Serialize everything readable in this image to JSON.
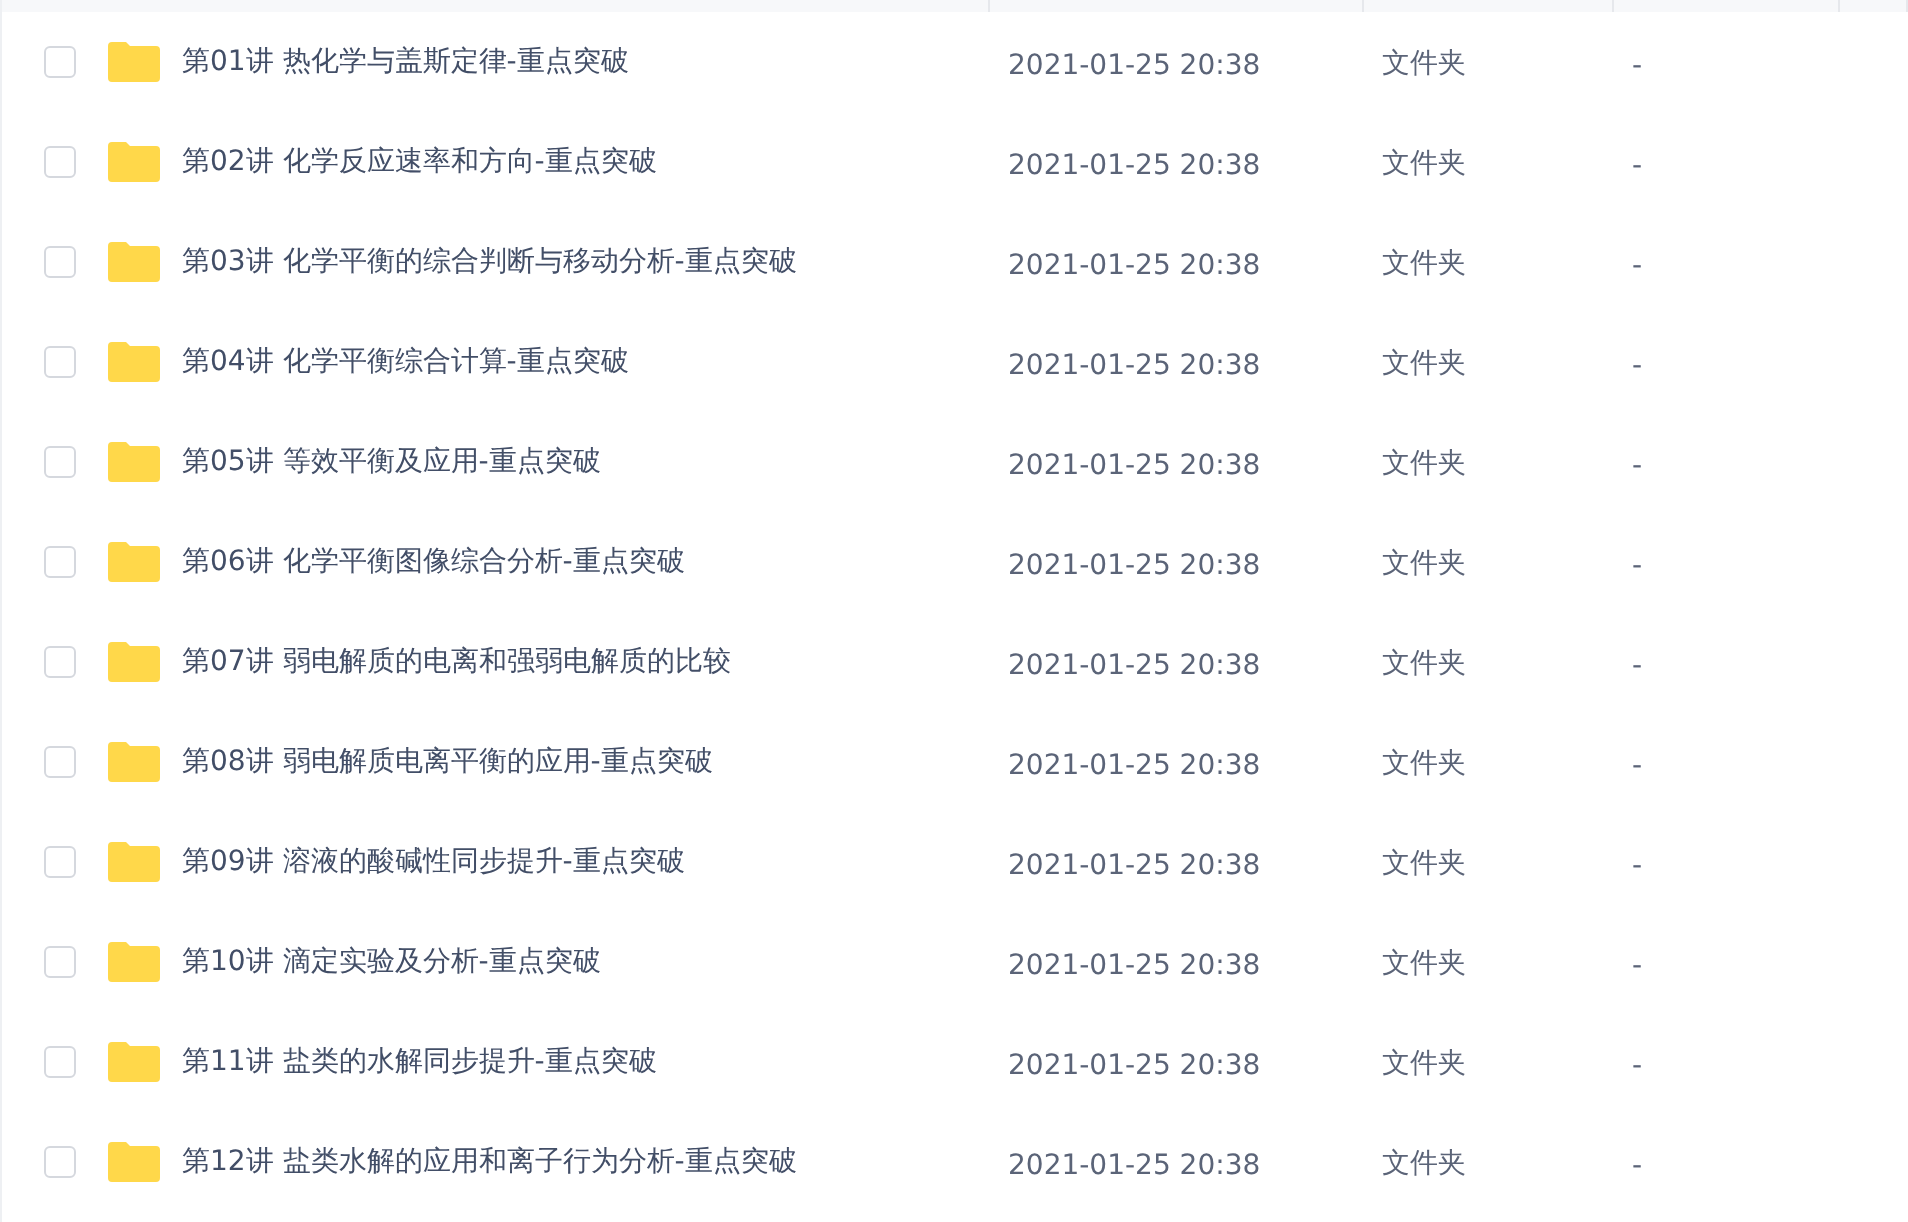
{
  "files": [
    {
      "name": "第01讲 热化学与盖斯定律-重点突破",
      "modified": "2021-01-25 20:38",
      "type": "文件夹",
      "size": "-",
      "checked": false
    },
    {
      "name": "第02讲 化学反应速率和方向-重点突破",
      "modified": "2021-01-25 20:38",
      "type": "文件夹",
      "size": "-",
      "checked": false
    },
    {
      "name": "第03讲 化学平衡的综合判断与移动分析-重点突破",
      "modified": "2021-01-25 20:38",
      "type": "文件夹",
      "size": "-",
      "checked": false
    },
    {
      "name": "第04讲 化学平衡综合计算-重点突破",
      "modified": "2021-01-25 20:38",
      "type": "文件夹",
      "size": "-",
      "checked": false
    },
    {
      "name": "第05讲 等效平衡及应用-重点突破",
      "modified": "2021-01-25 20:38",
      "type": "文件夹",
      "size": "-",
      "checked": false
    },
    {
      "name": "第06讲 化学平衡图像综合分析-重点突破",
      "modified": "2021-01-25 20:38",
      "type": "文件夹",
      "size": "-",
      "checked": false
    },
    {
      "name": "第07讲 弱电解质的电离和强弱电解质的比较",
      "modified": "2021-01-25 20:38",
      "type": "文件夹",
      "size": "-",
      "checked": false
    },
    {
      "name": "第08讲 弱电解质电离平衡的应用-重点突破",
      "modified": "2021-01-25 20:38",
      "type": "文件夹",
      "size": "-",
      "checked": false
    },
    {
      "name": "第09讲 溶液的酸碱性同步提升-重点突破",
      "modified": "2021-01-25 20:38",
      "type": "文件夹",
      "size": "-",
      "checked": false
    },
    {
      "name": "第10讲 滴定实验及分析-重点突破",
      "modified": "2021-01-25 20:38",
      "type": "文件夹",
      "size": "-",
      "checked": false
    },
    {
      "name": "第11讲 盐类的水解同步提升-重点突破",
      "modified": "2021-01-25 20:38",
      "type": "文件夹",
      "size": "-",
      "checked": false
    },
    {
      "name": "第12讲 盐类水解的应用和离子行为分析-重点突破",
      "modified": "2021-01-25 20:38",
      "type": "文件夹",
      "size": "-",
      "checked": false
    }
  ]
}
